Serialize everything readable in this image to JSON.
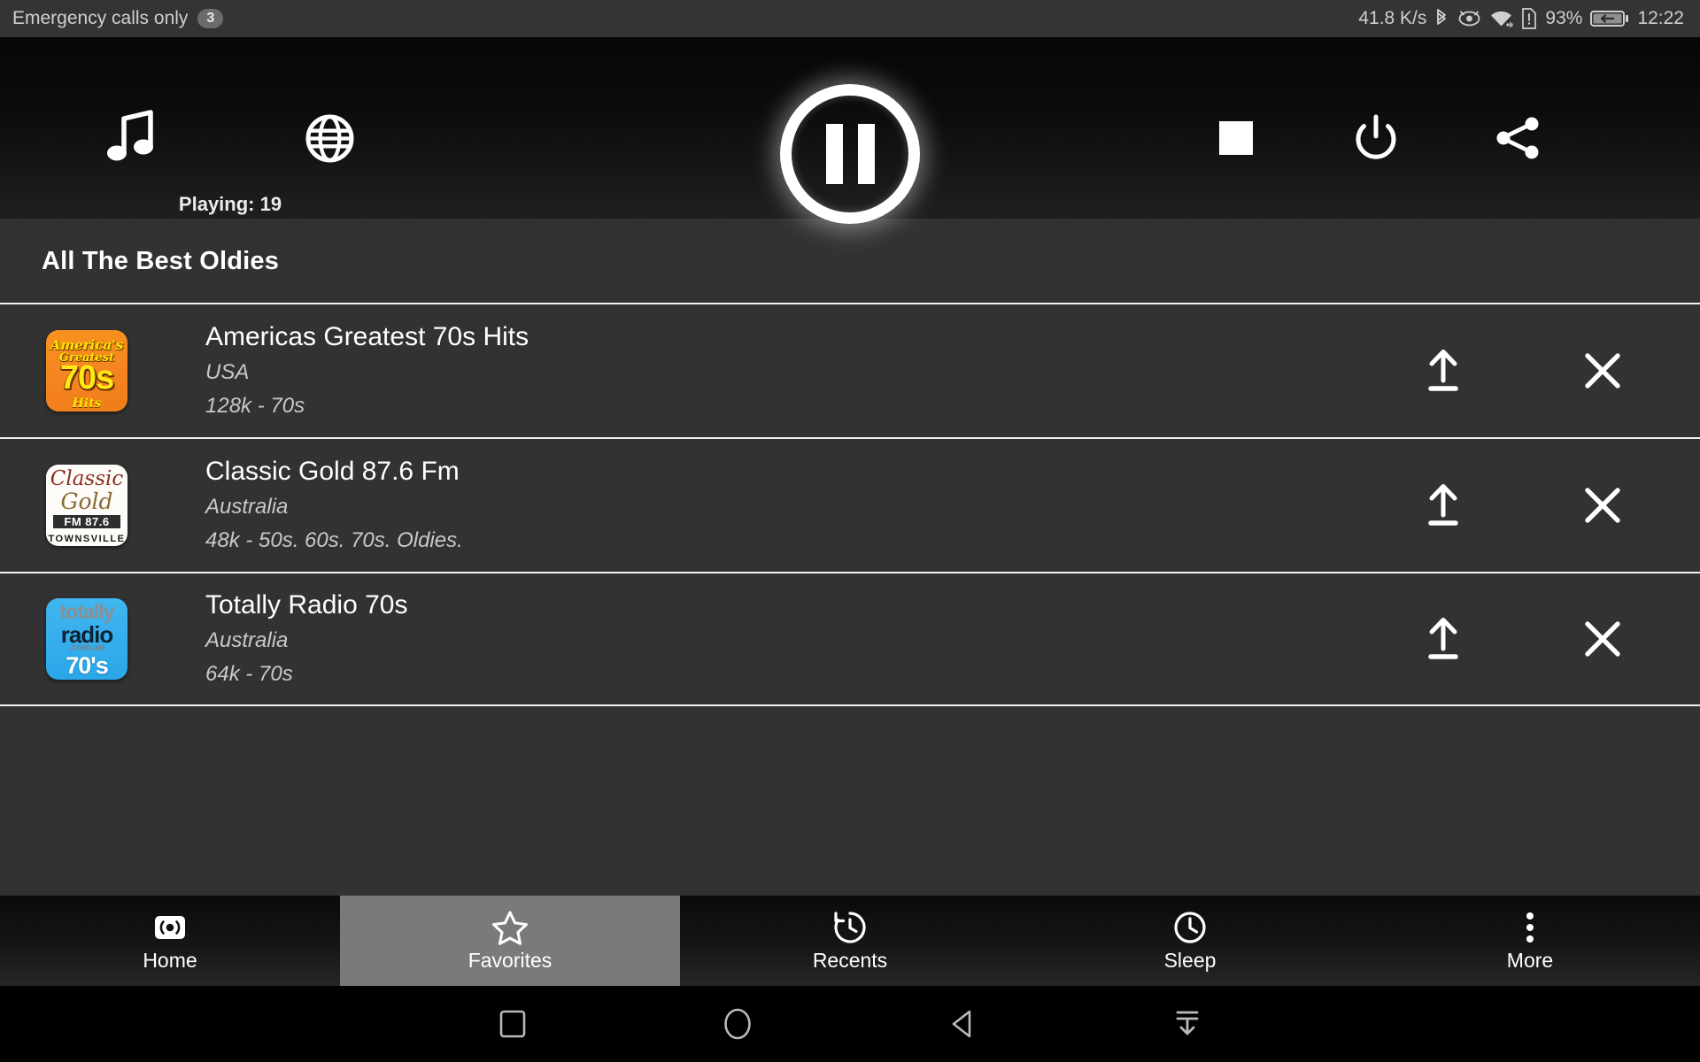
{
  "status_bar": {
    "carrier_text": "Emergency calls only",
    "notification_count": "3",
    "network_speed": "41.8 K/s",
    "battery_percent": "93%",
    "clock": "12:22",
    "icons": [
      "bluetooth-icon",
      "eye-icon",
      "wifi-icon",
      "sim-alert-icon",
      "battery-charging-icon"
    ]
  },
  "player_toolbar": {
    "music_icon": "music-note-icon",
    "globe_icon": "globe-icon",
    "stop_icon": "stop-icon",
    "power_icon": "power-icon",
    "share_icon": "share-icon",
    "playpause_icon": "pause-icon",
    "playing_label": "Playing: 19"
  },
  "section": {
    "title": "All The Best Oldies"
  },
  "stations": [
    {
      "name": "Americas Greatest 70s Hits",
      "country": "USA",
      "details": "128k - 70s",
      "logo": {
        "kind": "americas-greatest-70s",
        "line1": "America's",
        "line2": "Greatest",
        "line3": "70s",
        "line4": "Hits"
      },
      "move_action": "move-to-top",
      "remove_action": "remove"
    },
    {
      "name": "Classic Gold 87.6 Fm",
      "country": "Australia",
      "details": "48k - 50s. 60s. 70s. Oldies.",
      "logo": {
        "kind": "classic-gold",
        "line1": "Classic",
        "line2": "Gold",
        "line3": "FM 87.6",
        "line4": "TOWNSVILLE"
      },
      "move_action": "move-to-top",
      "remove_action": "remove"
    },
    {
      "name": "Totally Radio 70s",
      "country": "Australia",
      "details": "64k - 70s",
      "logo": {
        "kind": "totally-radio-70s",
        "line1": "totally",
        "line2": "radio",
        "line3": ".com.au",
        "line4": "70's"
      },
      "move_action": "move-to-top",
      "remove_action": "remove"
    }
  ],
  "bottom_tabs": [
    {
      "label": "Home",
      "icon": "broadcast-icon",
      "active": false
    },
    {
      "label": "Favorites",
      "icon": "star-icon",
      "active": true
    },
    {
      "label": "Recents",
      "icon": "history-icon",
      "active": false
    },
    {
      "label": "Sleep",
      "icon": "clock-icon",
      "active": false
    },
    {
      "label": "More",
      "icon": "overflow-dots-icon",
      "active": false
    }
  ],
  "android_nav": {
    "recents_icon": "square-icon",
    "home_icon": "circle-icon",
    "back_icon": "triangle-back-icon",
    "hide_icon": "hide-navbar-icon"
  },
  "colors": {
    "background": "#333232",
    "toolbar": "#0d0d0d",
    "status_bar": "#343434",
    "accent_white": "#ffffff",
    "tab_active": "#7a7a7a",
    "divider": "#f2f2f2"
  }
}
